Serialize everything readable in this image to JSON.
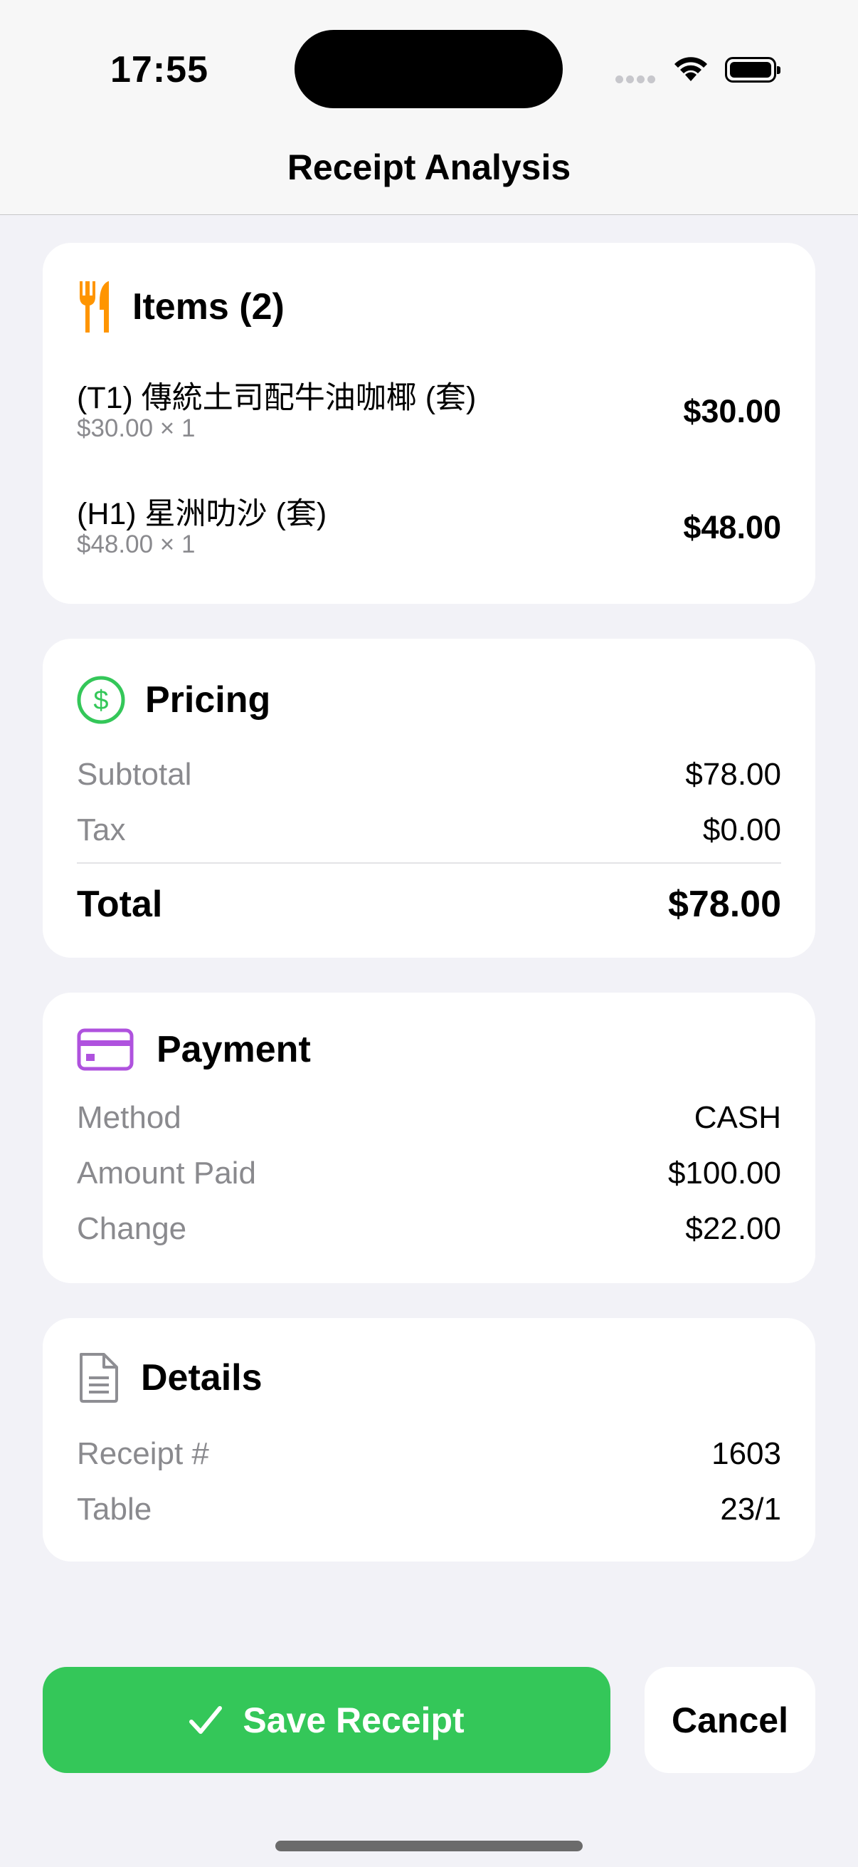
{
  "status_bar": {
    "time": "17:55"
  },
  "nav": {
    "title": "Receipt Analysis"
  },
  "items_card": {
    "title": "Items (2)",
    "icon": "fork-knife-icon",
    "items": [
      {
        "name": "(T1) 傳統土司配牛油咖椰 (套)",
        "detail": "$30.00 × 1",
        "price": "$30.00"
      },
      {
        "name": "(H1) 星洲叻沙 (套)",
        "detail": "$48.00 × 1",
        "price": "$48.00"
      }
    ]
  },
  "pricing_card": {
    "title": "Pricing",
    "icon": "dollar-circle-icon",
    "subtotal_label": "Subtotal",
    "subtotal_value": "$78.00",
    "tax_label": "Tax",
    "tax_value": "$0.00",
    "total_label": "Total",
    "total_value": "$78.00"
  },
  "payment_card": {
    "title": "Payment",
    "icon": "credit-card-icon",
    "method_label": "Method",
    "method_value": "CASH",
    "paid_label": "Amount Paid",
    "paid_value": "$100.00",
    "change_label": "Change",
    "change_value": "$22.00"
  },
  "details_card": {
    "title": "Details",
    "icon": "document-icon",
    "receipt_label": "Receipt #",
    "receipt_value": "1603",
    "table_label": "Table",
    "table_value": "23/1"
  },
  "actions": {
    "save_label": "Save Receipt",
    "cancel_label": "Cancel"
  },
  "colors": {
    "accent_green": "#34c759",
    "items_icon": "#ff9500",
    "pricing_icon": "#34c759",
    "payment_icon": "#af52de",
    "details_icon": "#8e8e93"
  }
}
